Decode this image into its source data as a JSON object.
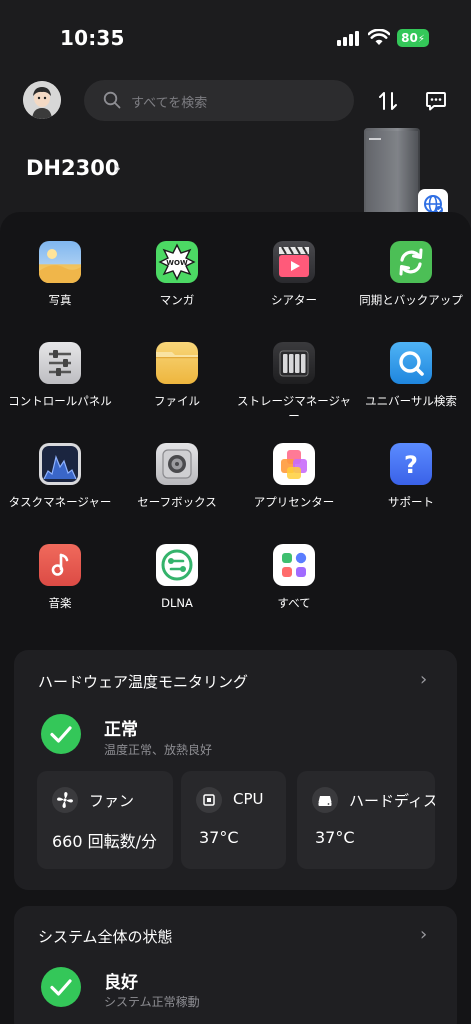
{
  "status_bar": {
    "time": "10:35",
    "battery": "80"
  },
  "search": {
    "placeholder": "すべてを検索"
  },
  "device": {
    "name": "DH2300"
  },
  "apps": [
    {
      "label": "写真",
      "icon": "photos-icon"
    },
    {
      "label": "マンガ",
      "icon": "manga-icon"
    },
    {
      "label": "シアター",
      "icon": "theater-icon"
    },
    {
      "label": "同期とバックアップ",
      "icon": "sync-backup-icon"
    },
    {
      "label": "コントロールパネル",
      "icon": "control-panel-icon"
    },
    {
      "label": "ファイル",
      "icon": "folder-icon"
    },
    {
      "label": "ストレージマネージャー",
      "icon": "storage-manager-icon"
    },
    {
      "label": "ユニバーサル検索",
      "icon": "universal-search-icon"
    },
    {
      "label": "タスクマネージャー",
      "icon": "task-manager-icon"
    },
    {
      "label": "セーフボックス",
      "icon": "safebox-icon"
    },
    {
      "label": "アプリセンター",
      "icon": "app-center-icon"
    },
    {
      "label": "サポート",
      "icon": "support-icon"
    },
    {
      "label": "音楽",
      "icon": "music-icon"
    },
    {
      "label": "DLNA",
      "icon": "dlna-icon"
    },
    {
      "label": "すべて",
      "icon": "all-apps-icon"
    }
  ],
  "hardware_card": {
    "title": "ハードウェア温度モニタリング",
    "status": "正常",
    "status_detail": "温度正常、放熱良好",
    "metrics": [
      {
        "label": "ファン",
        "value": "660 回転数/分",
        "icon": "fan-icon"
      },
      {
        "label": "CPU",
        "value": "37°C",
        "icon": "cpu-icon"
      },
      {
        "label": "ハードディスク",
        "value": "37°C",
        "icon": "hard-disk-icon"
      }
    ]
  },
  "system_card": {
    "title": "システム全体の状態",
    "status": "良好",
    "status_detail": "システム正常稼動"
  },
  "colors": {
    "background": "#1c1c1e",
    "panel": "#141416",
    "card": "#1f1f22",
    "ok_green": "#34c759"
  }
}
